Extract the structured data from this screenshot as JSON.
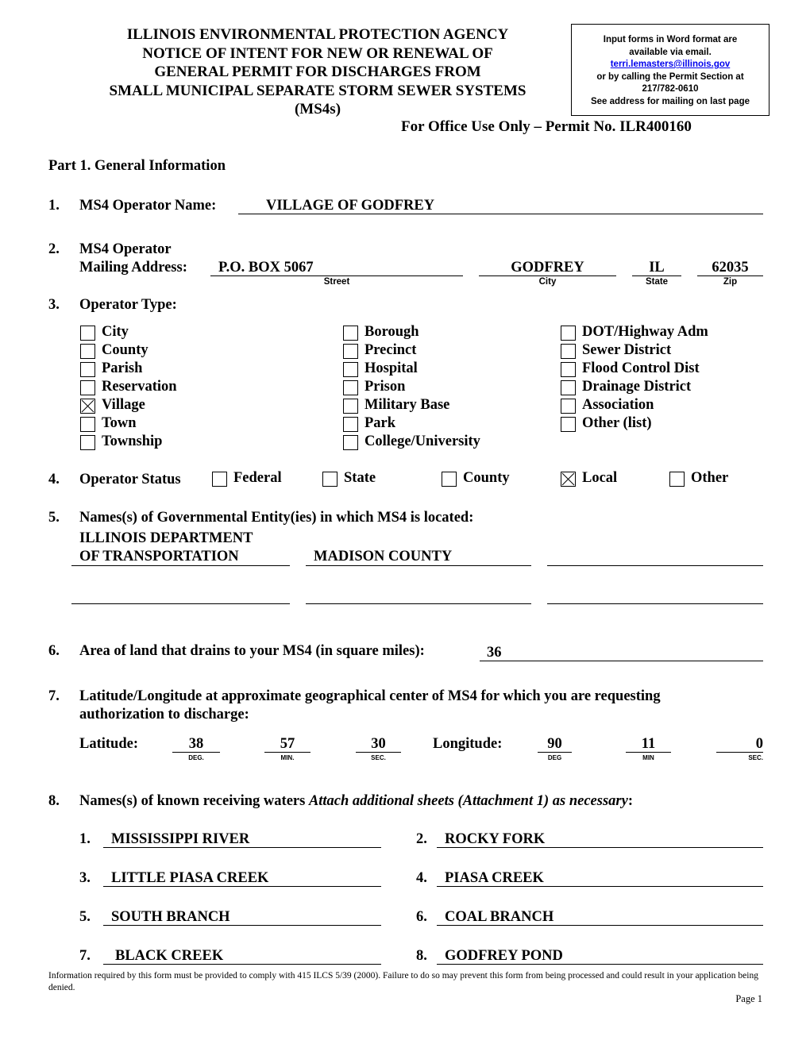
{
  "header": {
    "title_lines": [
      "ILLINOIS ENVIRONMENTAL PROTECTION AGENCY",
      "NOTICE OF INTENT FOR NEW OR RENEWAL OF",
      "GENERAL PERMIT FOR DISCHARGES FROM",
      "SMALL MUNICIPAL SEPARATE STORM SEWER SYSTEMS",
      "(MS4s)"
    ],
    "office_use": "For Office Use Only – Permit No. ILR400160"
  },
  "infobox": {
    "line1": "Input forms in Word format are",
    "line2": "available via email.",
    "email": "terri.lemasters@illinois.gov",
    "line3": "or by calling the Permit Section at",
    "phone": "217/782-0610",
    "line4": "See address for mailing on last page"
  },
  "part1": {
    "title": "Part 1. General Information"
  },
  "q1": {
    "num": "1.",
    "label": "MS4 Operator Name:",
    "value": "VILLAGE OF GODFREY"
  },
  "q2": {
    "num": "2.",
    "label_line1": "MS4 Operator",
    "label_line2": "Mailing Address:",
    "street": "P.O. BOX 5067",
    "city": "GODFREY",
    "state": "IL",
    "zip": "62035",
    "street_caption": "Street",
    "city_caption": "City",
    "state_caption": "State",
    "zip_caption": "Zip"
  },
  "q3": {
    "num": "3.",
    "label": "Operator Type:",
    "columns": [
      [
        {
          "label": "City",
          "checked": false
        },
        {
          "label": "County",
          "checked": false
        },
        {
          "label": "Parish",
          "checked": false
        },
        {
          "label": "Reservation",
          "checked": false
        },
        {
          "label": "Village",
          "checked": true
        },
        {
          "label": "Town",
          "checked": false
        },
        {
          "label": "Township",
          "checked": false
        }
      ],
      [
        {
          "label": "Borough",
          "checked": false
        },
        {
          "label": "Precinct",
          "checked": false
        },
        {
          "label": "Hospital",
          "checked": false
        },
        {
          "label": "Prison",
          "checked": false
        },
        {
          "label": "Military Base",
          "checked": false
        },
        {
          "label": "Park",
          "checked": false
        },
        {
          "label": "College/University",
          "checked": false
        }
      ],
      [
        {
          "label": "DOT/Highway Adm",
          "checked": false
        },
        {
          "label": "Sewer District",
          "checked": false
        },
        {
          "label": "Flood Control Dist",
          "checked": false
        },
        {
          "label": "Drainage District",
          "checked": false
        },
        {
          "label": "Association",
          "checked": false
        },
        {
          "label": "Other (list)",
          "checked": false
        }
      ]
    ]
  },
  "q4": {
    "num": "4.",
    "label": "Operator Status",
    "options": [
      {
        "label": "Federal",
        "checked": false
      },
      {
        "label": "State",
        "checked": false
      },
      {
        "label": "County",
        "checked": false
      },
      {
        "label": "Local",
        "checked": true
      },
      {
        "label": "Other",
        "checked": false
      }
    ]
  },
  "q5": {
    "num": "5.",
    "label": "Names(s) of Governmental Entity(ies) in which MS4 is located:",
    "entities": [
      "ILLINOIS DEPARTMENT",
      "OF TRANSPORTATION",
      "MADISON COUNTY",
      "",
      "",
      "",
      ""
    ]
  },
  "q6": {
    "num": "6.",
    "label": "Area of land that drains to your MS4 (in square miles):",
    "value": "36"
  },
  "q7": {
    "num": "7.",
    "label_line1": "Latitude/Longitude at approximate geographical center of MS4 for which you are requesting",
    "label_line2": "authorization to discharge:",
    "lat_label": "Latitude:",
    "lon_label": "Longitude:",
    "lat": {
      "deg": "38",
      "min": "57",
      "sec": "30"
    },
    "lon": {
      "deg": "90",
      "min": "11",
      "sec": "0"
    },
    "lat_captions": {
      "deg": "DEG.",
      "min": "MIN.",
      "sec": "SEC."
    },
    "lon_captions": {
      "deg": "DEG",
      "min": "MIN",
      "sec": "SEC."
    }
  },
  "q8": {
    "num": "8.",
    "label_plain": "Names(s) of known receiving waters ",
    "label_italic": "Attach additional sheets (Attachment 1) as necessary",
    "label_end": ":",
    "waters": [
      {
        "n": "1.",
        "name": "MISSISSIPPI RIVER"
      },
      {
        "n": "2.",
        "name": "ROCKY FORK"
      },
      {
        "n": "3.",
        "name": "LITTLE PIASA CREEK"
      },
      {
        "n": "4.",
        "name": "PIASA CREEK"
      },
      {
        "n": "5.",
        "name": "SOUTH BRANCH"
      },
      {
        "n": "6.",
        "name": "COAL BRANCH"
      },
      {
        "n": "7.",
        "name": "BLACK CREEK"
      },
      {
        "n": "8.",
        "name": "GODFREY POND"
      }
    ]
  },
  "footer": {
    "note": "Information required by this form must be provided to comply with 415 ILCS 5/39 (2000).  Failure to do so may prevent this form from being processed and could result in your application being denied.",
    "page": "Page 1"
  }
}
